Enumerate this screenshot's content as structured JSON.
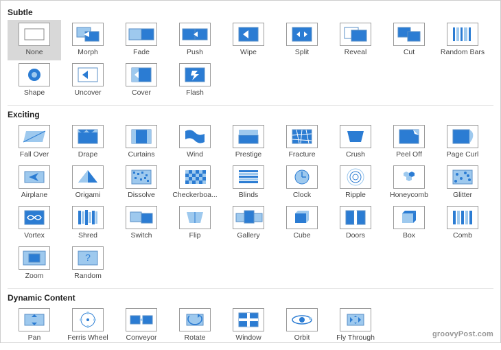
{
  "watermark": "groovyPost.com",
  "sections": [
    {
      "title": "Subtle",
      "items": [
        {
          "label": "None",
          "icon": "none",
          "selected": true
        },
        {
          "label": "Morph",
          "icon": "morph"
        },
        {
          "label": "Fade",
          "icon": "fade"
        },
        {
          "label": "Push",
          "icon": "push"
        },
        {
          "label": "Wipe",
          "icon": "wipe"
        },
        {
          "label": "Split",
          "icon": "split"
        },
        {
          "label": "Reveal",
          "icon": "reveal"
        },
        {
          "label": "Cut",
          "icon": "cut"
        },
        {
          "label": "Random Bars",
          "icon": "randombars"
        },
        {
          "label": "Shape",
          "icon": "shape"
        },
        {
          "label": "Uncover",
          "icon": "uncover"
        },
        {
          "label": "Cover",
          "icon": "cover"
        },
        {
          "label": "Flash",
          "icon": "flash"
        }
      ]
    },
    {
      "title": "Exciting",
      "items": [
        {
          "label": "Fall Over",
          "icon": "fallover"
        },
        {
          "label": "Drape",
          "icon": "drape"
        },
        {
          "label": "Curtains",
          "icon": "curtains"
        },
        {
          "label": "Wind",
          "icon": "wind"
        },
        {
          "label": "Prestige",
          "icon": "prestige"
        },
        {
          "label": "Fracture",
          "icon": "fracture"
        },
        {
          "label": "Crush",
          "icon": "crush"
        },
        {
          "label": "Peel Off",
          "icon": "peeloff"
        },
        {
          "label": "Page Curl",
          "icon": "pagecurl"
        },
        {
          "label": "Airplane",
          "icon": "airplane"
        },
        {
          "label": "Origami",
          "icon": "origami"
        },
        {
          "label": "Dissolve",
          "icon": "dissolve"
        },
        {
          "label": "Checkerboa...",
          "icon": "checkerboard"
        },
        {
          "label": "Blinds",
          "icon": "blinds"
        },
        {
          "label": "Clock",
          "icon": "clock"
        },
        {
          "label": "Ripple",
          "icon": "ripple"
        },
        {
          "label": "Honeycomb",
          "icon": "honeycomb"
        },
        {
          "label": "Glitter",
          "icon": "glitter"
        },
        {
          "label": "Vortex",
          "icon": "vortex"
        },
        {
          "label": "Shred",
          "icon": "shred"
        },
        {
          "label": "Switch",
          "icon": "switch"
        },
        {
          "label": "Flip",
          "icon": "flip"
        },
        {
          "label": "Gallery",
          "icon": "gallery"
        },
        {
          "label": "Cube",
          "icon": "cube"
        },
        {
          "label": "Doors",
          "icon": "doors"
        },
        {
          "label": "Box",
          "icon": "box"
        },
        {
          "label": "Comb",
          "icon": "comb"
        },
        {
          "label": "Zoom",
          "icon": "zoom"
        },
        {
          "label": "Random",
          "icon": "random"
        }
      ]
    },
    {
      "title": "Dynamic Content",
      "items": [
        {
          "label": "Pan",
          "icon": "pan"
        },
        {
          "label": "Ferris Wheel",
          "icon": "ferriswheel"
        },
        {
          "label": "Conveyor",
          "icon": "conveyor"
        },
        {
          "label": "Rotate",
          "icon": "rotate"
        },
        {
          "label": "Window",
          "icon": "window"
        },
        {
          "label": "Orbit",
          "icon": "orbit"
        },
        {
          "label": "Fly Through",
          "icon": "flythrough"
        }
      ]
    }
  ]
}
